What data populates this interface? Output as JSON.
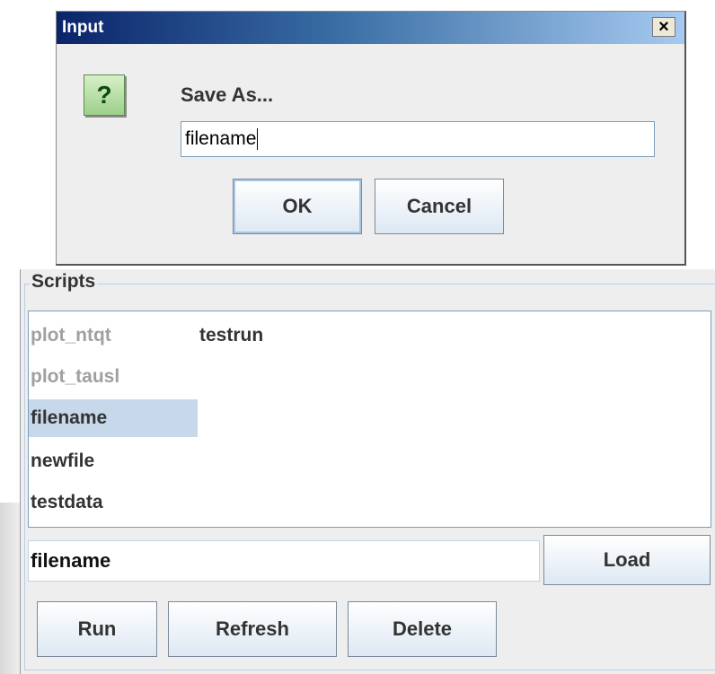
{
  "dialog": {
    "title": "Input",
    "close_glyph": "×",
    "icon": "question-icon",
    "icon_glyph": "?",
    "prompt": "Save As...",
    "input_value": "filename",
    "ok_label": "OK",
    "cancel_label": "Cancel"
  },
  "scripts": {
    "group_title": "Scripts",
    "list": {
      "column1": [
        {
          "label": "plot_ntqt",
          "state": "dim"
        },
        {
          "label": "plot_tausl",
          "state": "dim"
        },
        {
          "label": "filename",
          "state": "selected"
        },
        {
          "label": "newfile",
          "state": "normal"
        },
        {
          "label": "testdata",
          "state": "normal"
        }
      ],
      "column2": [
        {
          "label": "testrun",
          "state": "normal"
        }
      ]
    },
    "name_field_value": "filename",
    "load_label": "Load",
    "run_label": "Run",
    "refresh_label": "Refresh",
    "delete_label": "Delete"
  },
  "colors": {
    "titlebar_start": "#0a246a",
    "titlebar_end": "#a6caf0",
    "selection": "#c6d8ea",
    "dim_text": "#a0a0a0"
  }
}
